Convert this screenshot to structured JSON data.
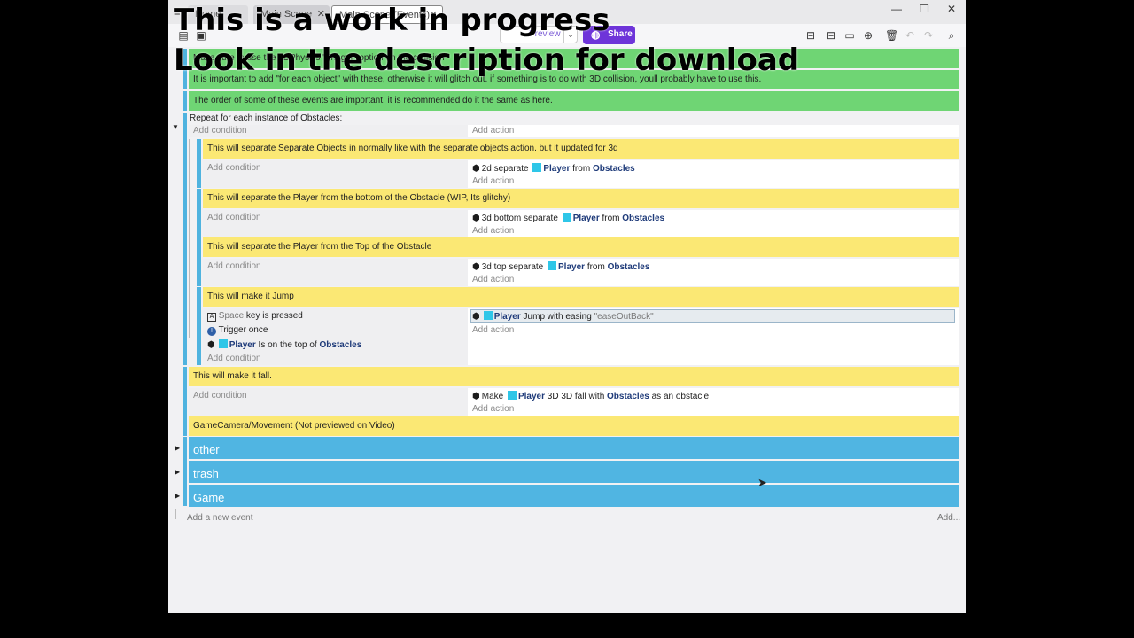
{
  "tabs": [
    {
      "label": "Home"
    },
    {
      "label": "Main Scene"
    },
    {
      "label": "Main Scene (Events)"
    }
  ],
  "toolbar": {
    "preview_label": "Preview",
    "share_label": "Share"
  },
  "comments": {
    "c1": "Make sure to use the 3DPhysics \"Trigger\" option on the collision",
    "c2": "It is important to add \"for each object\" with these, otherwise it will glitch out. if something is to do with 3D collision, youll probably have to use this.",
    "c3": "The order of some of these events are important. it is recommended do it the same as here.",
    "c4": "This will separate Separate Objects in normally like with the separate objects action. but it updated for 3d",
    "c5": "This will separate the Player from the bottom of the Obstacle (WIP, Its glitchy)",
    "c6": "This will separate the Player from the Top of the Obstacle",
    "c7": "This will make it Jump",
    "c8": "This will make it fall.",
    "c9": "GameCamera/Movement (Not previewed on Video)"
  },
  "repeat_label": "Repeat for each instance of Obstacles:",
  "add_condition": "Add condition",
  "add_action": "Add action",
  "actions": {
    "a1_prefix": "2d separate",
    "a2_prefix": "3d bottom separate",
    "a3_prefix": "3d top separate",
    "from": "from",
    "player": "Player",
    "obstacles": "Obstacles",
    "jump_mid": "Jump with easing",
    "jump_easing": "\"easeOutBack\"",
    "make": "Make",
    "fall_mid": "3D 3D fall with",
    "fall_suffix": "as an obstacle"
  },
  "conditions": {
    "space": "Space",
    "key_pressed": "key is pressed",
    "trigger_once": "Trigger once",
    "on_top": "Is on the top of"
  },
  "groups": [
    {
      "label": "other"
    },
    {
      "label": "trash"
    },
    {
      "label": "Game"
    }
  ],
  "footer": {
    "add_event": "Add a new event",
    "add_more": "Add..."
  },
  "overlay": {
    "line1": "This is a work in progress",
    "line2": "Look in the description for download"
  }
}
